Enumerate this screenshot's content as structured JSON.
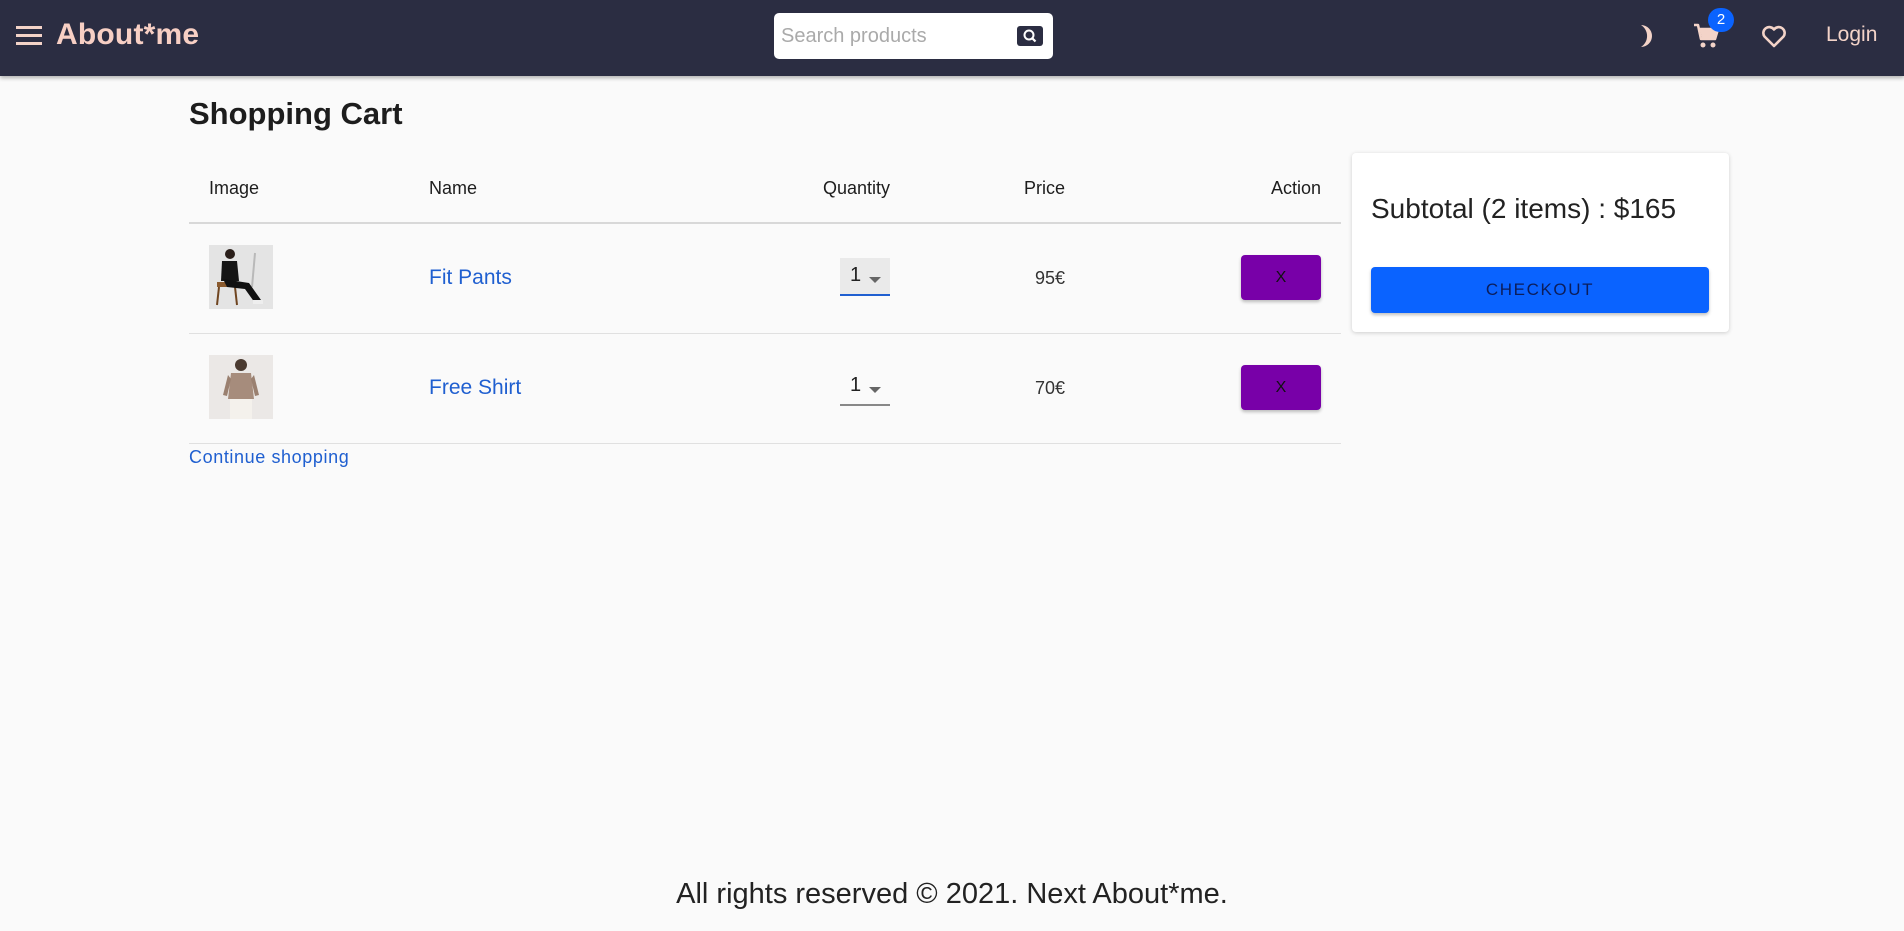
{
  "header": {
    "brand": "About*me",
    "search_placeholder": "Search products",
    "cart_count": "2",
    "login_label": "Login",
    "icons": [
      "menu-icon",
      "search-icon",
      "moon-icon",
      "cart-icon",
      "heart-icon"
    ],
    "bar_color": "#2b2d42",
    "brand_color": "#f7cfc4"
  },
  "main": {
    "title": "Shopping Cart",
    "columns": [
      "Image",
      "Name",
      "Quantity",
      "Price",
      "Action"
    ],
    "items": [
      {
        "name": "Fit Pants",
        "quantity": "1",
        "price": "95€",
        "remove_label": "X"
      },
      {
        "name": "Free Shirt",
        "quantity": "1",
        "price": "70€",
        "remove_label": "X"
      }
    ],
    "continue_label": "Continue shopping"
  },
  "summary": {
    "subtotal_text": "Subtotal (2 items) : $165",
    "checkout_label": "CHECKOUT",
    "checkout_color": "#0a63ff",
    "remove_color": "#7800a8"
  },
  "footer": {
    "text": "All rights reserved © 2021. Next About*me."
  }
}
